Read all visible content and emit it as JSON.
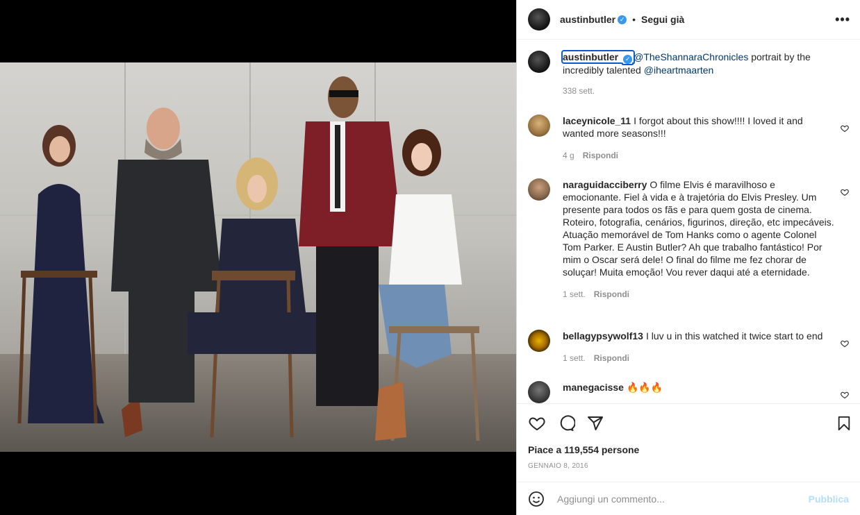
{
  "post": {
    "username": "austinbutler",
    "follow_label": "Segui già",
    "more_label": "•••"
  },
  "caption": {
    "username": "austinbutler",
    "mention1": "@TheShannaraChronicles",
    "text_mid": " portrait by the incredibly talented ",
    "mention2": "@iheartmaarten",
    "time": "338 sett."
  },
  "comments": [
    {
      "username": "laceynicole_11",
      "text": "I forgot about this show!!!! I loved it and wanted more seasons!!!",
      "time": "4 g",
      "reply": "Rispondi"
    },
    {
      "username": "naraguidacciberry",
      "text": "O filme Elvis é maravilhoso e emocionante. Fiel à vida e à trajetória do Elvis Presley. Um presente para todos os fãs e para quem gosta de cinema. Roteiro, fotografia, cenários, figurinos, direção, etc impecáveis. Atuação memorável de Tom Hanks como o agente Colonel Tom Parker. E Austin Butler? Ah que trabalho fantástico! Por mim o Oscar será dele! O final do filme me fez chorar de soluçar! Muita emoção! Vou rever daqui até a eternidade.",
      "time": "1 sett.",
      "reply": "Rispondi"
    },
    {
      "username": "bellagypsywolf13",
      "text": "I luv u in this watched it twice start to end",
      "time": "1 sett.",
      "reply": "Rispondi"
    },
    {
      "username": "manegacisse",
      "text": "🔥🔥🔥"
    }
  ],
  "likes": "Piace a 119,554 persone",
  "date": "Gennaio 8, 2016",
  "add_comment": {
    "placeholder": "Aggiungi un commento...",
    "publish": "Pubblica"
  },
  "icons": [
    "heart-icon",
    "comment-icon",
    "share-icon",
    "bookmark-icon",
    "emoji-icon",
    "more-icon"
  ]
}
